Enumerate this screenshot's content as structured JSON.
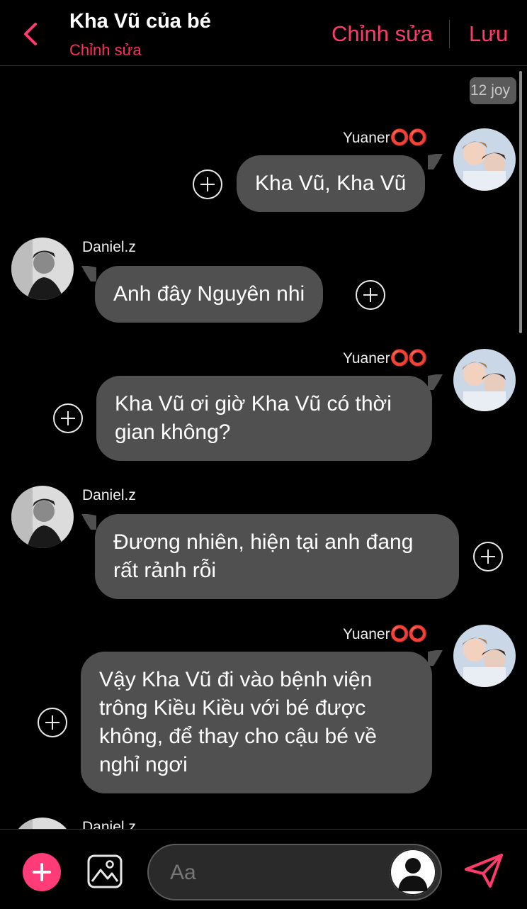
{
  "header": {
    "title": "Kha Vũ của bé",
    "subtitle": "Chỉnh sửa",
    "edit_label": "Chỉnh sửa",
    "save_label": "Lưu"
  },
  "chat": {
    "time_badge": "12 joy",
    "messages": [
      {
        "sender": "Yuaner",
        "sender_rings": "⭕⭕",
        "side": "right",
        "text": "Kha Vũ, Kha Vũ"
      },
      {
        "sender": "Daniel.z",
        "side": "left",
        "text": "Anh đây Nguyên nhi"
      },
      {
        "sender": "Yuaner",
        "sender_rings": "⭕⭕",
        "side": "right",
        "text": "Kha Vũ ơi giờ Kha Vũ có thời gian không?"
      },
      {
        "sender": "Daniel.z",
        "side": "left",
        "text": "Đương nhiên, hiện tại anh đang rất rảnh rỗi"
      },
      {
        "sender": "Yuaner",
        "sender_rings": "⭕⭕",
        "side": "right",
        "text": "Vậy Kha Vũ đi vào bệnh viện trông Kiều Kiều với bé được không, để thay cho cậu bé về nghỉ ngơi"
      },
      {
        "sender": "Daniel.z",
        "side": "left",
        "text": ""
      }
    ]
  },
  "composer": {
    "placeholder": "Aa"
  },
  "colors": {
    "accent": "#ff3b6b",
    "bubble": "#505050",
    "background": "#000000"
  },
  "icons": [
    "chevron-left-icon",
    "plus-circle-icon",
    "image-icon",
    "user-icon",
    "send-icon"
  ]
}
